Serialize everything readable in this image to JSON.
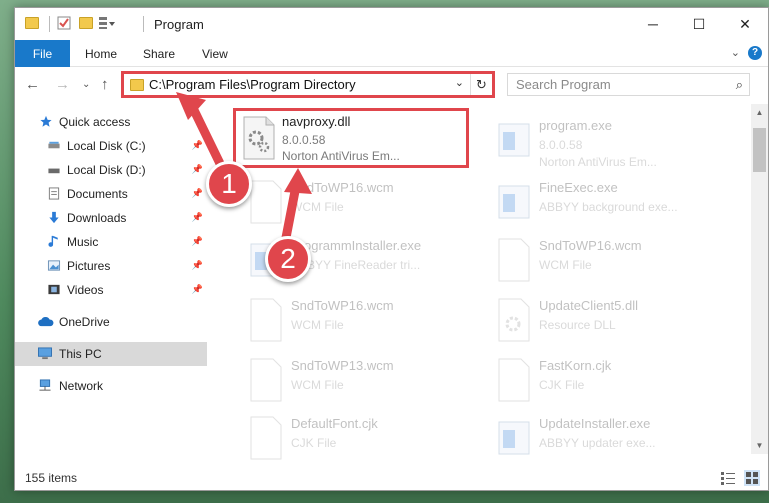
{
  "window": {
    "title": "Program",
    "minimize_glyph": "─",
    "maximize_glyph": "☐",
    "close_glyph": "✕"
  },
  "ribbon": {
    "tabs": [
      "File",
      "Home",
      "Share",
      "View"
    ],
    "expand_glyph": "⌄",
    "help_glyph": "?"
  },
  "nav": {
    "back_glyph": "←",
    "forward_glyph": "→",
    "recent_glyph": "⌄",
    "up_glyph": "↑",
    "address": "C:\\Program Files\\Program Directory",
    "address_dropdown_glyph": "⌄",
    "refresh_glyph": "↻",
    "search_placeholder": "Search Program",
    "search_icon_glyph": "⌕"
  },
  "sidebar": {
    "items": [
      {
        "label": "Quick access",
        "icon": "star-icon",
        "pinned": false
      },
      {
        "label": "Local Disk (C:)",
        "icon": "drive-icon",
        "pinned": true
      },
      {
        "label": "Local Disk (D:)",
        "icon": "drive-icon",
        "pinned": true
      },
      {
        "label": "Documents",
        "icon": "documents-icon",
        "pinned": true
      },
      {
        "label": "Downloads",
        "icon": "download-icon",
        "pinned": true
      },
      {
        "label": "Music",
        "icon": "music-icon",
        "pinned": true
      },
      {
        "label": "Pictures",
        "icon": "pictures-icon",
        "pinned": true
      },
      {
        "label": "Videos",
        "icon": "videos-icon",
        "pinned": true
      },
      {
        "label": "OneDrive",
        "icon": "cloud-icon",
        "pinned": false
      },
      {
        "label": "This PC",
        "icon": "computer-icon",
        "pinned": false,
        "selected": true
      },
      {
        "label": "Network",
        "icon": "network-icon",
        "pinned": false
      }
    ],
    "pin_glyph": "📌"
  },
  "files": {
    "highlighted": {
      "name": "navproxy.dll",
      "version": "8.0.0.58",
      "description": "Norton AntiVirus Em..."
    },
    "faded": [
      {
        "name": "program.exe",
        "line2": "8.0.0.58",
        "line3": "Norton AntiVirus Em..."
      },
      {
        "name": "SndToWP16.wcm",
        "line2": "WCM File"
      },
      {
        "name": "FineExec.exe",
        "line2": "ABBYY background exe..."
      },
      {
        "name": "ProgrammInstaller.exe",
        "line2": "ABBYY FineReader tri..."
      },
      {
        "name": "SndToWP16.wcm",
        "line2": "WCM File"
      },
      {
        "name": "SndToWP16.wcm",
        "line2": "WCM File"
      },
      {
        "name": "UpdateClient5.dll",
        "line2": "Resource DLL"
      },
      {
        "name": "SndToWP13.wcm",
        "line2": "WCM File"
      },
      {
        "name": "FastKorn.cjk",
        "line2": "CJK File"
      },
      {
        "name": "DefaultFont.cjk",
        "line2": "CJK File"
      },
      {
        "name": "UpdateInstaller.exe",
        "line2": "ABBYY updater exe..."
      }
    ]
  },
  "status": {
    "item_count": "155 items"
  },
  "callouts": [
    "1",
    "2"
  ],
  "colors": {
    "accent": "#1979ca",
    "highlight": "#e0464c",
    "selected": "#d9d9d9"
  }
}
